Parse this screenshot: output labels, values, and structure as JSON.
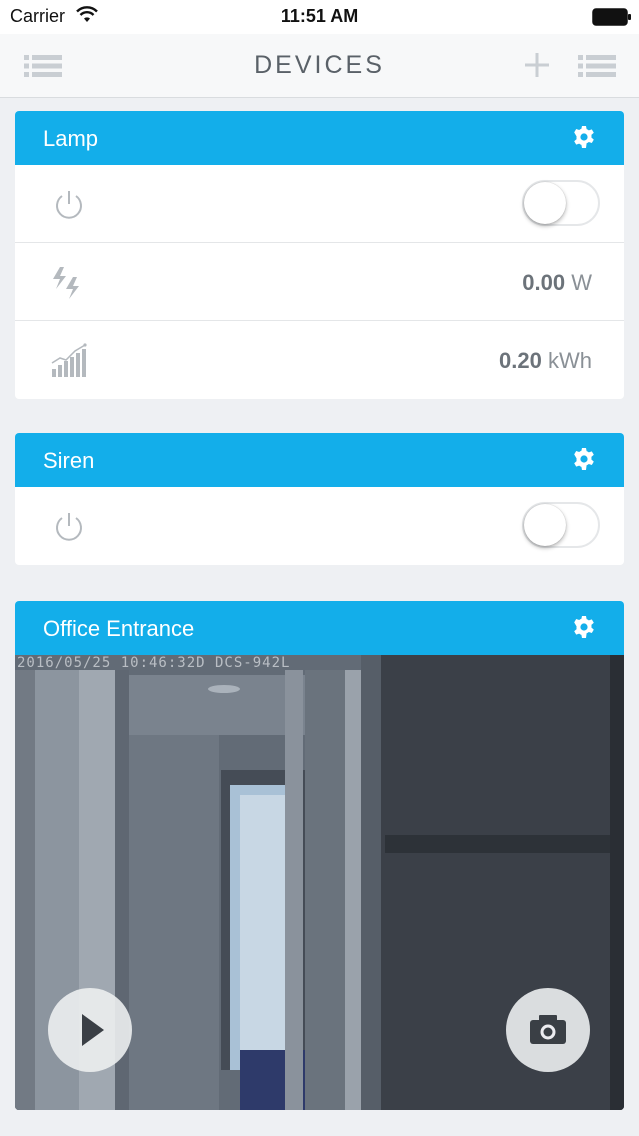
{
  "status_bar": {
    "carrier": "Carrier",
    "time": "11:51 AM",
    "wifi_icon": "wifi-icon",
    "battery_icon": "battery-icon"
  },
  "nav": {
    "title": "DEVICES",
    "left_icon": "list-menu-icon",
    "add_icon": "plus-icon",
    "right_icon": "list-menu-icon"
  },
  "colors": {
    "accent": "#13aeea",
    "background": "#eef0f3",
    "muted_icon": "#b4b9be"
  },
  "devices": [
    {
      "name": "Lamp",
      "settings_icon": "gear-icon",
      "power_icon": "power-icon",
      "power_on": false,
      "power_label": "W",
      "power_value": "0.00",
      "power_icon_name": "lightning-icon",
      "energy_value": "0.20",
      "energy_unit": "kWh",
      "energy_icon_name": "bar-chart-trend-icon"
    },
    {
      "name": "Siren",
      "settings_icon": "gear-icon",
      "power_icon": "power-icon",
      "power_on": false
    },
    {
      "name": "Office Entrance",
      "settings_icon": "gear-icon",
      "camera_timestamp": "2016/05/25 10:46:32D DCS-942L",
      "play_icon": "play-icon",
      "snapshot_icon": "camera-icon"
    }
  ]
}
